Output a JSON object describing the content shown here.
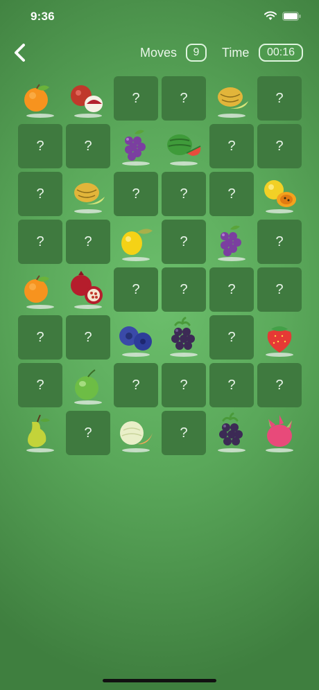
{
  "status_bar": {
    "time": "9:36",
    "icons": [
      "wifi-icon",
      "battery-icon"
    ]
  },
  "header": {
    "back_icon": "chevron-left-icon",
    "moves_label": "Moves",
    "moves_value": "9",
    "time_label": "Time",
    "time_value": "00:16"
  },
  "board": {
    "columns": 6,
    "rows": 8,
    "hidden_symbol": "?",
    "tiles": [
      [
        "orange",
        "lychee",
        "?",
        "?",
        "melon",
        "?"
      ],
      [
        "?",
        "?",
        "grapes",
        "watermelon",
        "?",
        "?"
      ],
      [
        "?",
        "melon",
        "?",
        "?",
        "?",
        "passion-fruit"
      ],
      [
        "?",
        "?",
        "lemon",
        "?",
        "grapes",
        "?"
      ],
      [
        "orange",
        "pomegranate",
        "?",
        "?",
        "?",
        "?"
      ],
      [
        "?",
        "?",
        "blueberry",
        "blackberry",
        "?",
        "strawberry"
      ],
      [
        "?",
        "guava",
        "?",
        "?",
        "?",
        "?"
      ],
      [
        "pear",
        "?",
        "cantaloupe",
        "?",
        "blackberry",
        "dragon-fruit"
      ]
    ]
  },
  "colors": {
    "background": "#5aa85a",
    "tile_hidden": "#3f7a3f",
    "badge_border": "#dff5df"
  }
}
